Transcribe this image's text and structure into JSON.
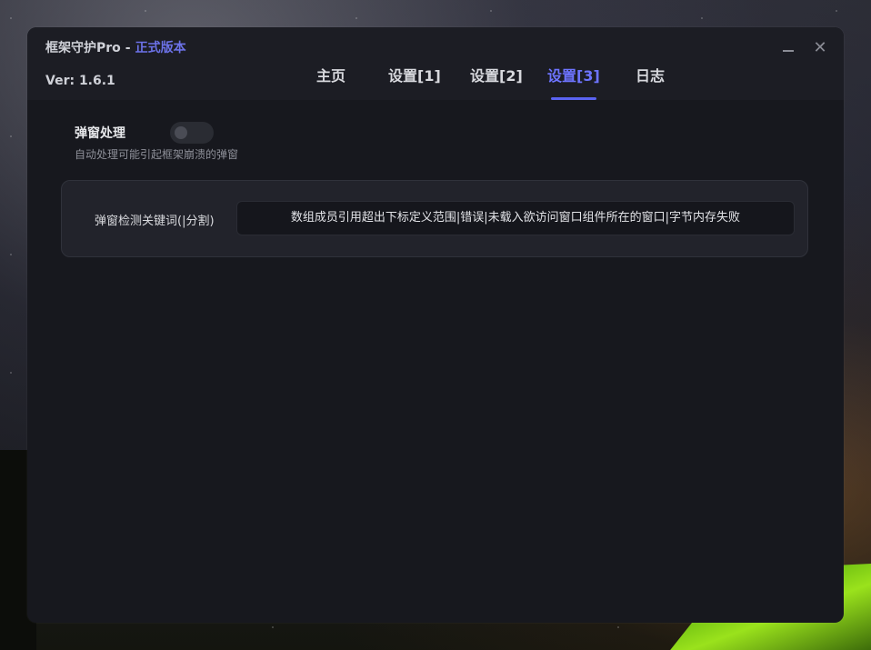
{
  "window": {
    "app_name": "框架守护Pro",
    "separator": "-",
    "edition": "正式版本",
    "version": "Ver: 1.6.1",
    "close_glyph": "✕"
  },
  "tabs": [
    {
      "label": "主页",
      "active": false
    },
    {
      "label": "设置[1]",
      "active": false
    },
    {
      "label": "设置[2]",
      "active": false
    },
    {
      "label": "设置[3]",
      "active": true
    },
    {
      "label": "日志",
      "active": false
    }
  ],
  "popup_handling": {
    "title": "弹窗处理",
    "description": "自动处理可能引起框架崩溃的弹窗",
    "toggle_on": false
  },
  "keywords": {
    "label": "弹窗检测关键词(|分割)",
    "value": "数组成员引用超出下标定义范围|错误|未载入欲访问窗口组件所在的窗口|字节内存失败"
  },
  "colors": {
    "accent": "#6d74ff",
    "window_bg": "#17181e",
    "titlebar_bg": "#1c1d24"
  }
}
